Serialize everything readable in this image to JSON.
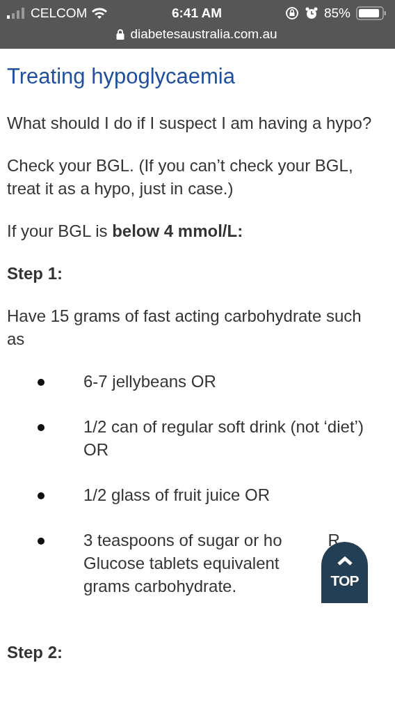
{
  "status_bar": {
    "carrier": "CELCOM",
    "time": "6:41 AM",
    "battery": "85%",
    "url": "diabetesaustralia.com.au"
  },
  "article": {
    "title": "Treating hypoglycaemia",
    "blocks": [
      {
        "kind": "paragraph",
        "text": "What should I do if I suspect I am having a hypo?"
      },
      {
        "kind": "paragraph",
        "text": "Check your BGL. (If you can’t check your BGL, treat it as a hypo, just in case.)"
      },
      {
        "kind": "paragraph",
        "text": "If your BGL is **below 4 mmol/L:**"
      },
      {
        "kind": "heading",
        "text": "Step 1:"
      },
      {
        "kind": "paragraph",
        "text": "Have 15 grams of fast acting carbohydrate such as"
      },
      {
        "kind": "list",
        "items": [
          {
            "text": "6-7 jellybeans OR"
          },
          {
            "text": "1/2 can of regular soft drink (not ‘diet’) OR"
          },
          {
            "text": "1/2 glass of fruit juice OR"
          },
          {
            "lines": [
              [
                "3 teaspoons of sugar or ho",
                "R"
              ],
              [
                "Glucose tablets equivalent"
              ],
              [
                "grams carbohydrate."
              ]
            ]
          }
        ]
      },
      {
        "kind": "heading",
        "text": "Step 2:"
      }
    ]
  },
  "top_button": {
    "label": "TOP"
  }
}
